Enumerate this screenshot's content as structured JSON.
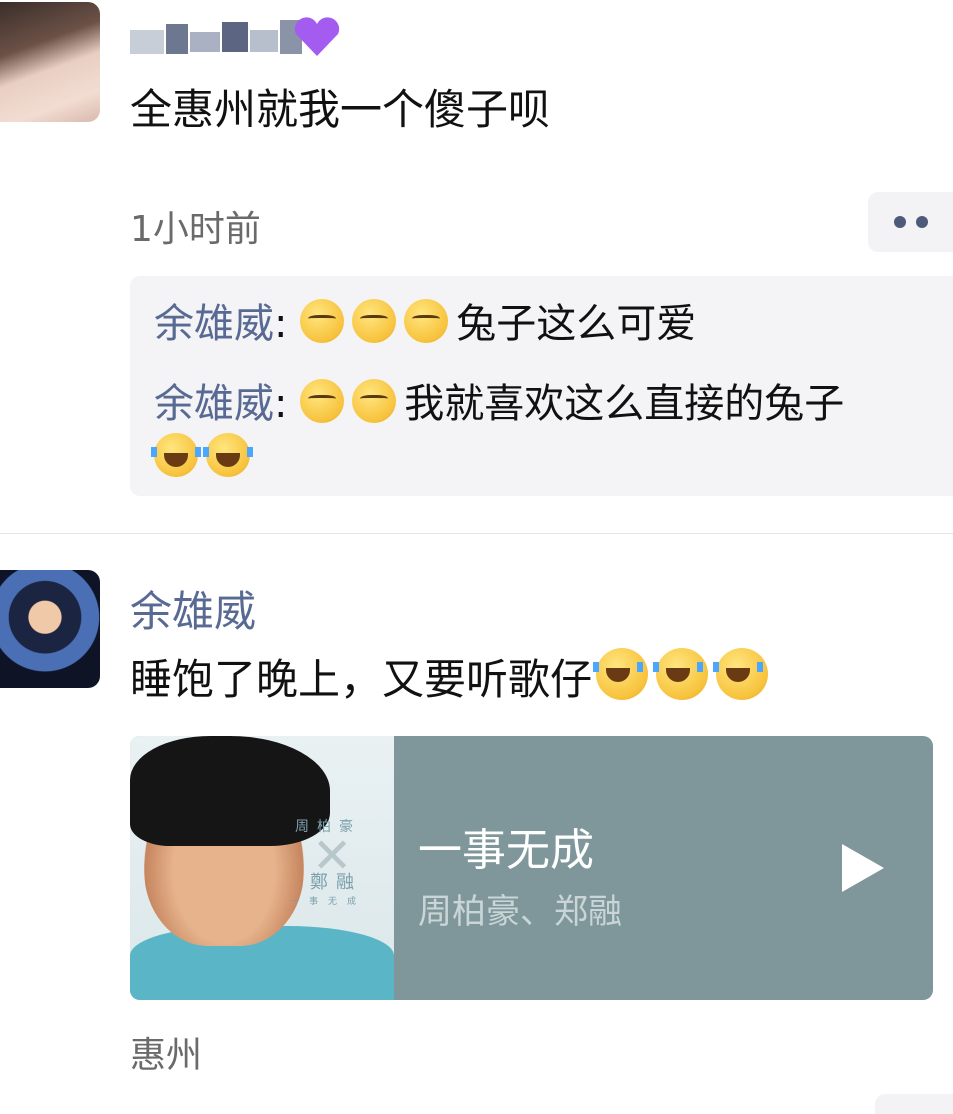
{
  "post1": {
    "text": "全惠州就我一个傻子呗",
    "time": "1小时前",
    "comments": [
      {
        "author": "余雄威",
        "sep": ":",
        "text": "兔子这么可爱",
        "emojis_before": [
          "smirk",
          "smirk",
          "smirk"
        ]
      },
      {
        "author": "余雄威",
        "sep": ":",
        "text": "我就喜欢这么直接的兔子",
        "emojis_before": [
          "smirk",
          "smirk"
        ],
        "emojis_after": [
          "laugh",
          "laugh"
        ]
      }
    ]
  },
  "post2": {
    "author": "余雄威",
    "text": "睡饱了晚上，又要听歌仔",
    "music": {
      "title": "一事无成",
      "artist": "周柏豪、郑融",
      "art_text_top": "周柏豪",
      "art_text_bottom": "鄭融",
      "art_text_sub": "一事无成"
    },
    "location": "惠州"
  },
  "colors": {
    "name_link": "#586a94",
    "music_card_bg": "#7f979b",
    "comment_bg": "#f4f4f6"
  }
}
